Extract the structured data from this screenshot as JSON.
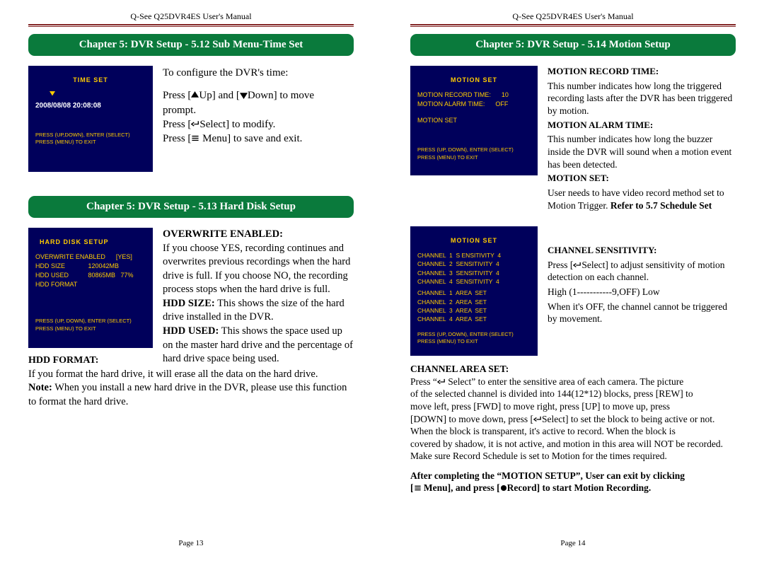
{
  "header": "Q-See Q25DVR4ES User's Manual",
  "page_left_footer": "Page 13",
  "page_right_footer": "Page 14",
  "left": {
    "sec1_title": "Chapter 5: DVR Setup - 5.12 Sub Menu-Time Set",
    "sec1_screen_title": "TIME SET",
    "sec1_screen_datetime": "2008/08/08 20:08:08",
    "sec1_screen_instr1": "PRESS (UP,DOWN),  ENTER (SELECT)",
    "sec1_screen_instr2": "PRESS (MENU)  TO  EXIT",
    "sec1_desc_l1": "To configure the DVR's time:",
    "sec1_desc_l2a": "  Press [",
    "sec1_desc_l2b": "Up] and [",
    "sec1_desc_l2c": "Down] to move",
    "sec1_desc_l3": "  prompt.",
    "sec1_desc_l4a": "Press [",
    "sec1_desc_l4b": "Select] to modify.",
    "sec1_desc_l5a": "Press [",
    "sec1_desc_l5b": " Menu] to save and exit.",
    "sec2_title": "Chapter 5: DVR Setup - 5.13 Hard Disk Setup",
    "sec2_screen_title": "HARD DISK SETUP",
    "sec2_screen_l1": "OVERWRITE ENABLED      [YES]",
    "sec2_screen_l2": "HDD SIZE             120042MB",
    "sec2_screen_l3": "HDD USED           80865MB   77%",
    "sec2_screen_l4": "HDD FORMAT",
    "sec2_screen_instr1": "PRESS (UP, DOWN),  ENTER (SELECT)",
    "sec2_screen_instr2": "PRESS (MENU)  TO  EXIT",
    "sec2_h1": "OVERWRITE ENABLED:",
    "sec2_p1": "If you choose YES, recording continues and overwrites previous recordings when the hard drive is full. If you choose NO, the recording process stops when the hard drive is full.",
    "sec2_h2": "HDD SIZE:",
    "sec2_p2": " This shows the size of the hard drive installed in the DVR.",
    "sec2_h3": "HDD USED:",
    "sec2_p3": " This shows the space used up on the master hard drive and the percentage of hard drive space being used.",
    "sec2_hdd_fmt": "HDD FORMAT:",
    "sec2_p4": "If you format the hard drive, it will erase all the data on the hard drive.",
    "sec2_note_b": "Note:",
    "sec2_note": " When you install a new hard drive in the DVR, please use this function to format the hard drive."
  },
  "right": {
    "sec_title": "Chapter 5: DVR Setup - 5.14 Motion Setup",
    "scr1_title": "MOTION SET",
    "scr1_l1": "MOTION RECORD TIME:      10",
    "scr1_l2": "MOTION ALARM TIME:      OFF",
    "scr1_l3": "MOTION SET",
    "scr1_instr1": "PRESS (UP, DOWN),  ENTER (SELECT)",
    "scr1_instr2": "PRESS (MENU)  TO  EXIT",
    "r1_h1": "MOTION RECORD TIME:",
    "r1_p1": "This number indicates how long the triggered recording lasts after the DVR has been triggered by motion.",
    "r1_h2": "MOTION ALARM TIME:",
    "r1_p2": "This number indicates how long the buzzer inside the DVR will sound when a motion event has been detected.",
    "r1_h3": "MOTION SET:",
    "r1_p3a": "User needs to have video record method set to Motion Trigger. ",
    "r1_p3b": "Refer to 5.7 Schedule Set",
    "scr2_title": "MOTION SET",
    "scr2_l1": "CHANNEL  1  S ENSITIVITY  4",
    "scr2_l2": "CHANNEL  2  SENSITIVITY  4",
    "scr2_l3": "CHANNEL  3  SENSITIVITY  4",
    "scr2_l4": "CHANNEL  4  SENSITIVITY  4",
    "scr2_l5": "CHANNEL  1  AREA  SET",
    "scr2_l6": "CHANNEL  2  AREA  SET",
    "scr2_l7": "CHANNEL  3  AREA  SET",
    "scr2_l8": "CHANNEL  4  AREA  SET",
    "scr2_instr1": "PRESS (UP, DOWN),  ENTER (SELECT)",
    "scr2_instr2": "PRESS (MENU)  TO  EXIT",
    "r2_h1": "CHANNEL SENSITIVITY:",
    "r2_p1a": "  Press [",
    "r2_p1b": "Select] to adjust sensitivity of motion detection on each channel.",
    "r2_p2": "  High (1-----------9,OFF) Low",
    "r2_p3": "  When it's OFF, the channel cannot be triggered by movement.",
    "cas_h": "CHANNEL AREA SET:",
    "cas_p1a": "     Press “",
    "cas_p1b": " Select” to enter the sensitive area of each camera. The picture",
    "cas_p2": "  of the selected channel is divided into 144(12*12) blocks, press [REW] to",
    "cas_p3": "  move left, press [FWD] to move right, press [UP] to move up, press",
    "cas_p4a": "  [DOWN] to move down, press [",
    "cas_p4b": "Select] to set the block to being active or not.",
    "cas_p5": "     When the block is transparent, it's active to record. When the block is",
    "cas_p6": "  covered by shadow, it is not active, and motion in this area will NOT be recorded.",
    "cas_p7": "  Make sure Record Schedule is set to Motion for the times required.",
    "final_b1": "After completing the “MOTION SETUP”, User can exit by clicking",
    "final_b2a": "[",
    "final_b2b": " Menu], and press [",
    "final_b2c": "Record] to start Motion Recording."
  }
}
